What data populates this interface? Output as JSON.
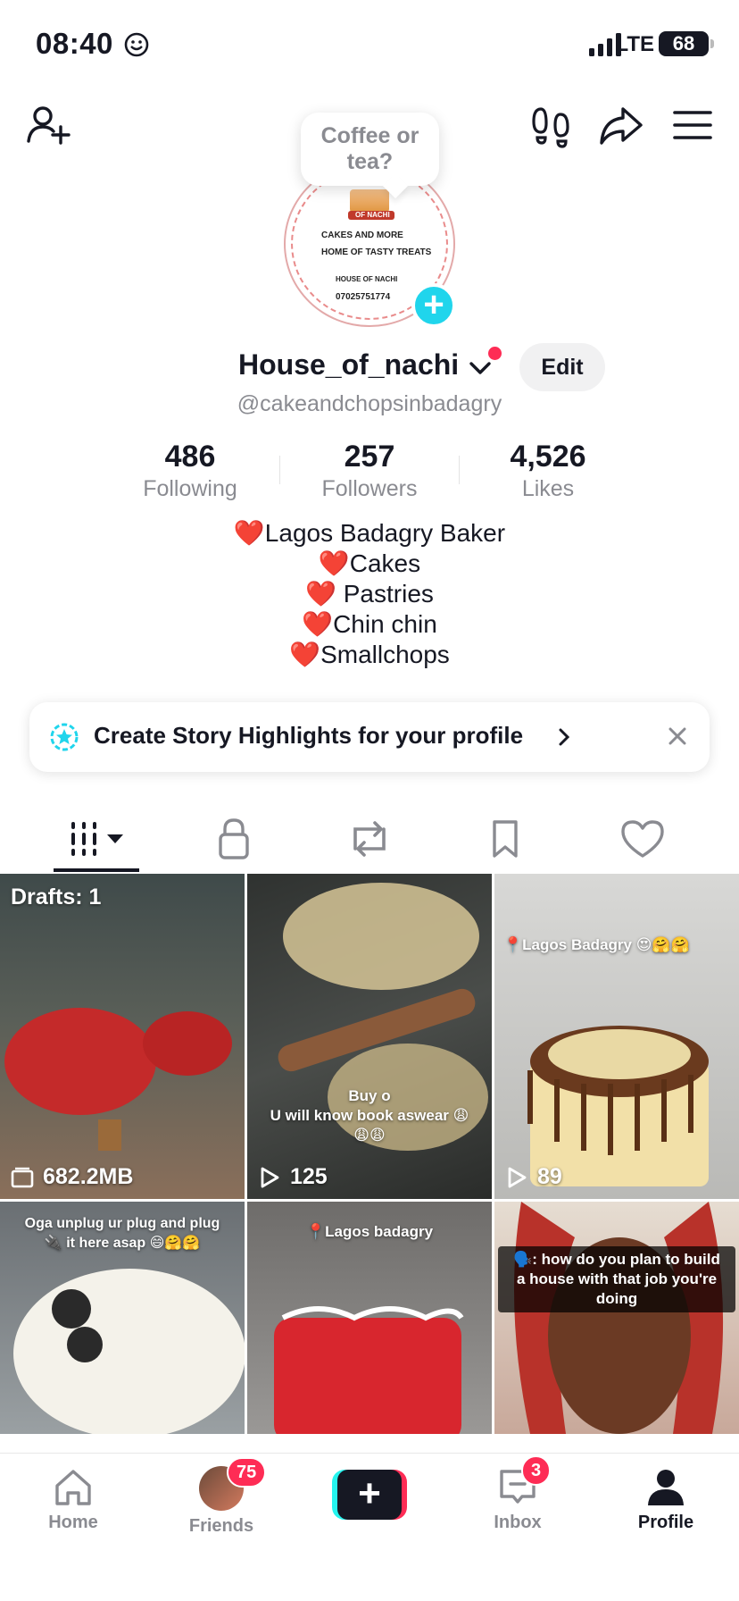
{
  "status_bar": {
    "time": "08:40",
    "network": "LTE",
    "battery": "68"
  },
  "profile": {
    "status_bubble": "Coffee or tea?",
    "avatar_lines": [
      "OF NACHI",
      "CAKES AND MORE",
      "HOME OF TASTY TREATS",
      "HOUSE OF NACHI",
      "07025751774"
    ],
    "name": "House_of_nachi",
    "edit_label": "Edit",
    "handle": "@cakeandchopsinbadagry",
    "stats": [
      {
        "value": "486",
        "label": "Following"
      },
      {
        "value": "257",
        "label": "Followers"
      },
      {
        "value": "4,526",
        "label": "Likes"
      }
    ],
    "bio": [
      {
        "heart": "❤️",
        "text": "Lagos Badagry Baker"
      },
      {
        "heart": "❤️",
        "text": "Cakes"
      },
      {
        "heart": "❤️",
        "text": " Pastries"
      },
      {
        "heart": "❤️",
        "text": "Chin chin"
      },
      {
        "heart": "❤️",
        "text": "Smallchops"
      }
    ]
  },
  "story_card": {
    "text": "Create Story Highlights for your profile"
  },
  "tabs": [
    "videos-grid",
    "private",
    "reposts",
    "favorites",
    "liked"
  ],
  "grid": [
    {
      "top_text": "Drafts: 1",
      "bottom_text": "682.2MB",
      "bg": "#4a4f4f"
    },
    {
      "center_text": "Buy o\nU will know book aswear 😩\n😩😩",
      "views": "125",
      "bg": "#3a3a38"
    },
    {
      "top_text": "📍Lagos Badagry 😍🤗🤗",
      "views": "89",
      "bg": "#cfcfcd"
    },
    {
      "top_text": "Oga unplug ur plug and plug\n🔌 it here asap 😄🤗🤗",
      "bg": "#7a7f84"
    },
    {
      "top_text": "📍Lagos badagry",
      "bg": "#8c8a88"
    },
    {
      "top_text": "🗣️: how do you plan to build\na house with that job you're\ndoing",
      "bg": "#c9b3a3"
    }
  ],
  "bottom_nav": {
    "home": "Home",
    "friends": "Friends",
    "friends_badge": "75",
    "inbox": "Inbox",
    "inbox_badge": "3",
    "profile": "Profile"
  },
  "colors": {
    "accent": "#fe2c55",
    "cyan": "#25f4ee",
    "add": "#20d5ec"
  }
}
